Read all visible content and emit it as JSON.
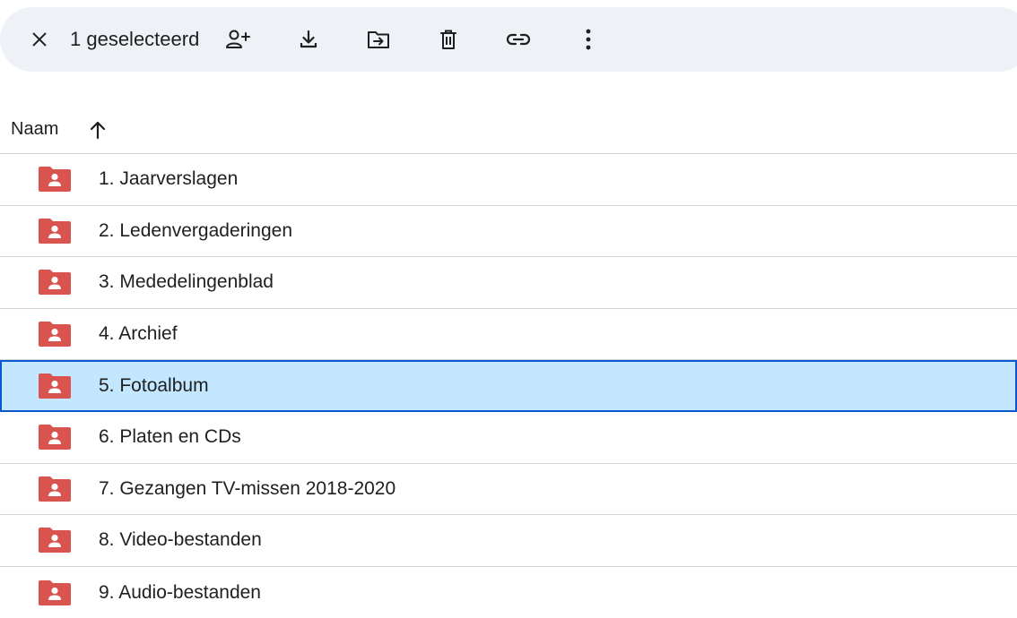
{
  "toolbar": {
    "selection_text": "1 geselecteerd",
    "icons": [
      "close-icon",
      "share-person-add-icon",
      "download-icon",
      "move-to-folder-icon",
      "trash-icon",
      "link-icon",
      "more-vert-icon"
    ]
  },
  "header": {
    "name_column_label": "Naam",
    "sort_icon": "arrow-up-icon",
    "sort_direction": "ascending"
  },
  "folders": [
    {
      "label": "1. Jaarverslagen",
      "selected": false
    },
    {
      "label": "2. Ledenvergaderingen",
      "selected": false
    },
    {
      "label": "3. Mededelingenblad",
      "selected": false
    },
    {
      "label": "4. Archief",
      "selected": false
    },
    {
      "label": "5. Fotoalbum",
      "selected": true
    },
    {
      "label": "6. Platen en CDs",
      "selected": false
    },
    {
      "label": "7. Gezangen TV-missen 2018-2020",
      "selected": false
    },
    {
      "label": "8. Video-bestanden",
      "selected": false
    },
    {
      "label": "9. Audio-bestanden",
      "selected": false
    }
  ],
  "colors": {
    "toolbar_bg": "#eef1f6",
    "folder_icon": "#d9534f",
    "selected_bg": "#c2e7ff",
    "selected_border": "#0b57d0",
    "divider": "#d0d3d8"
  }
}
